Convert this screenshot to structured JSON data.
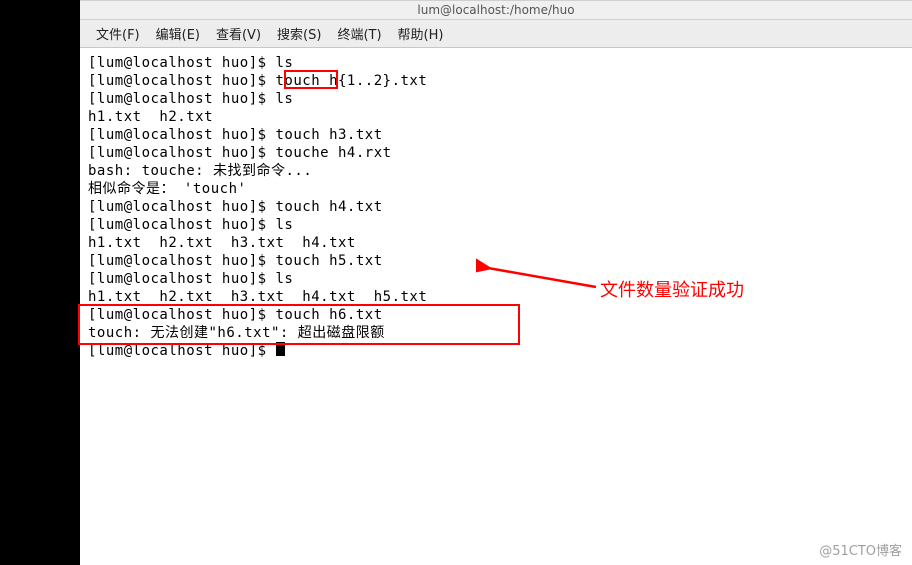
{
  "window": {
    "title": "lum@localhost:/home/huo"
  },
  "menubar": {
    "items": [
      "文件(F)",
      "编辑(E)",
      "查看(V)",
      "搜索(S)",
      "终端(T)",
      "帮助(H)"
    ]
  },
  "prompt": "[lum@localhost huo]$ ",
  "terminal": {
    "lines": [
      "[lum@localhost huo]$ ls",
      "[lum@localhost huo]$ touch h{1..2}.txt",
      "[lum@localhost huo]$ ls",
      "h1.txt  h2.txt",
      "[lum@localhost huo]$ touch h3.txt",
      "[lum@localhost huo]$ touche h4.rxt",
      "bash: touche: 未找到命令...",
      "相似命令是： 'touch'",
      "[lum@localhost huo]$ touch h4.txt",
      "[lum@localhost huo]$ ls",
      "h1.txt  h2.txt  h3.txt  h4.txt",
      "[lum@localhost huo]$ touch h5.txt",
      "[lum@localhost huo]$ ls",
      "h1.txt  h2.txt  h3.txt  h4.txt  h5.txt",
      "[lum@localhost huo]$ touch h6.txt",
      "touch: 无法创建\"h6.txt\": 超出磁盘限额",
      "[lum@localhost huo]$ "
    ]
  },
  "annotations": {
    "success_text": "文件数量验证成功"
  },
  "watermark": "@51CTO博客",
  "colors": {
    "highlight": "#ff0000"
  }
}
